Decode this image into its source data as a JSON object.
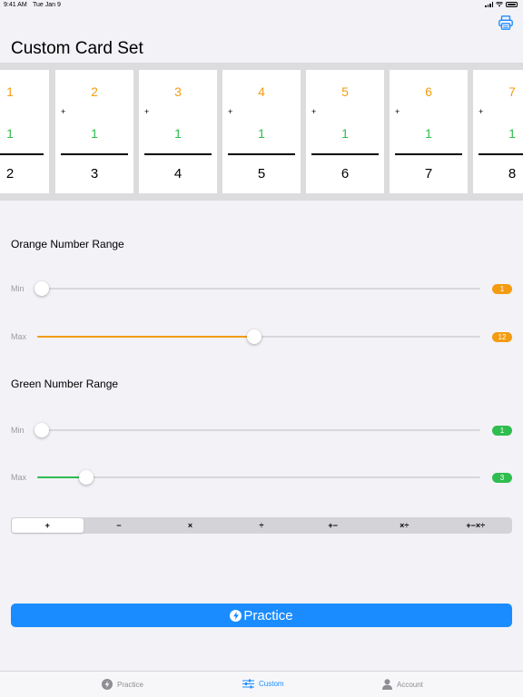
{
  "status_bar": {
    "time": "9:41 AM",
    "date": "Tue Jan 9"
  },
  "title": "Custom Card Set",
  "cards": [
    {
      "top": "1",
      "op": "",
      "mid": "1",
      "answer": "2"
    },
    {
      "top": "2",
      "op": "+",
      "mid": "1",
      "answer": "3"
    },
    {
      "top": "3",
      "op": "+",
      "mid": "1",
      "answer": "4"
    },
    {
      "top": "4",
      "op": "+",
      "mid": "1",
      "answer": "5"
    },
    {
      "top": "5",
      "op": "+",
      "mid": "1",
      "answer": "6"
    },
    {
      "top": "6",
      "op": "+",
      "mid": "1",
      "answer": "7"
    },
    {
      "top": "7",
      "op": "+",
      "mid": "1",
      "answer": "8"
    }
  ],
  "orange_range": {
    "title": "Orange Number Range",
    "min_label": "Min",
    "min_value": "1",
    "max_label": "Max",
    "max_value": "12",
    "min_fraction": 0.0,
    "max_fraction": 0.48
  },
  "green_range": {
    "title": "Green Number Range",
    "min_label": "Min",
    "min_value": "1",
    "max_label": "Max",
    "max_value": "3",
    "min_fraction": 0.0,
    "max_fraction": 0.1
  },
  "operations": {
    "options": [
      "+",
      "−",
      "×",
      "÷",
      "+−",
      "×÷",
      "+−×÷"
    ],
    "selected_index": 0
  },
  "practice_button": {
    "label": "Practice"
  },
  "tab_bar": {
    "items": [
      {
        "label": "Practice",
        "icon": "bolt-icon",
        "active": false
      },
      {
        "label": "Custom",
        "icon": "sliders-icon",
        "active": true
      },
      {
        "label": "Account",
        "icon": "person-icon",
        "active": false
      }
    ]
  },
  "colors": {
    "orange": "#f39c12",
    "green": "#2ebd4e",
    "accent": "#1a8cff"
  }
}
